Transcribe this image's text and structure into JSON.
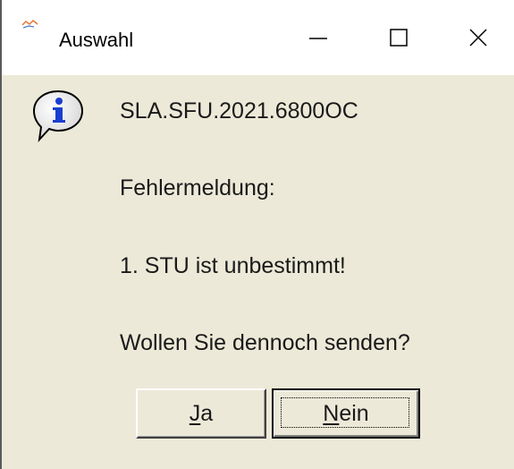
{
  "window": {
    "title": "Auswahl",
    "controls": [
      "minimize",
      "maximize",
      "close"
    ]
  },
  "icons": {
    "app": "app-icon",
    "info": "info-icon"
  },
  "message": {
    "line1": "SLA.SFU.2021.6800OC",
    "line2": "Fehlermeldung:",
    "line3": "1. STU ist unbestimmt!",
    "line4": "Wollen Sie dennoch senden?"
  },
  "buttons": {
    "yes": {
      "mnemonic": "J",
      "rest": "a"
    },
    "no": {
      "mnemonic": "N",
      "rest": "ein"
    }
  },
  "colors": {
    "dialog_bg": "#ece9d8",
    "titlebar_bg": "#ffffff",
    "info_blue": "#1a3fd0"
  }
}
